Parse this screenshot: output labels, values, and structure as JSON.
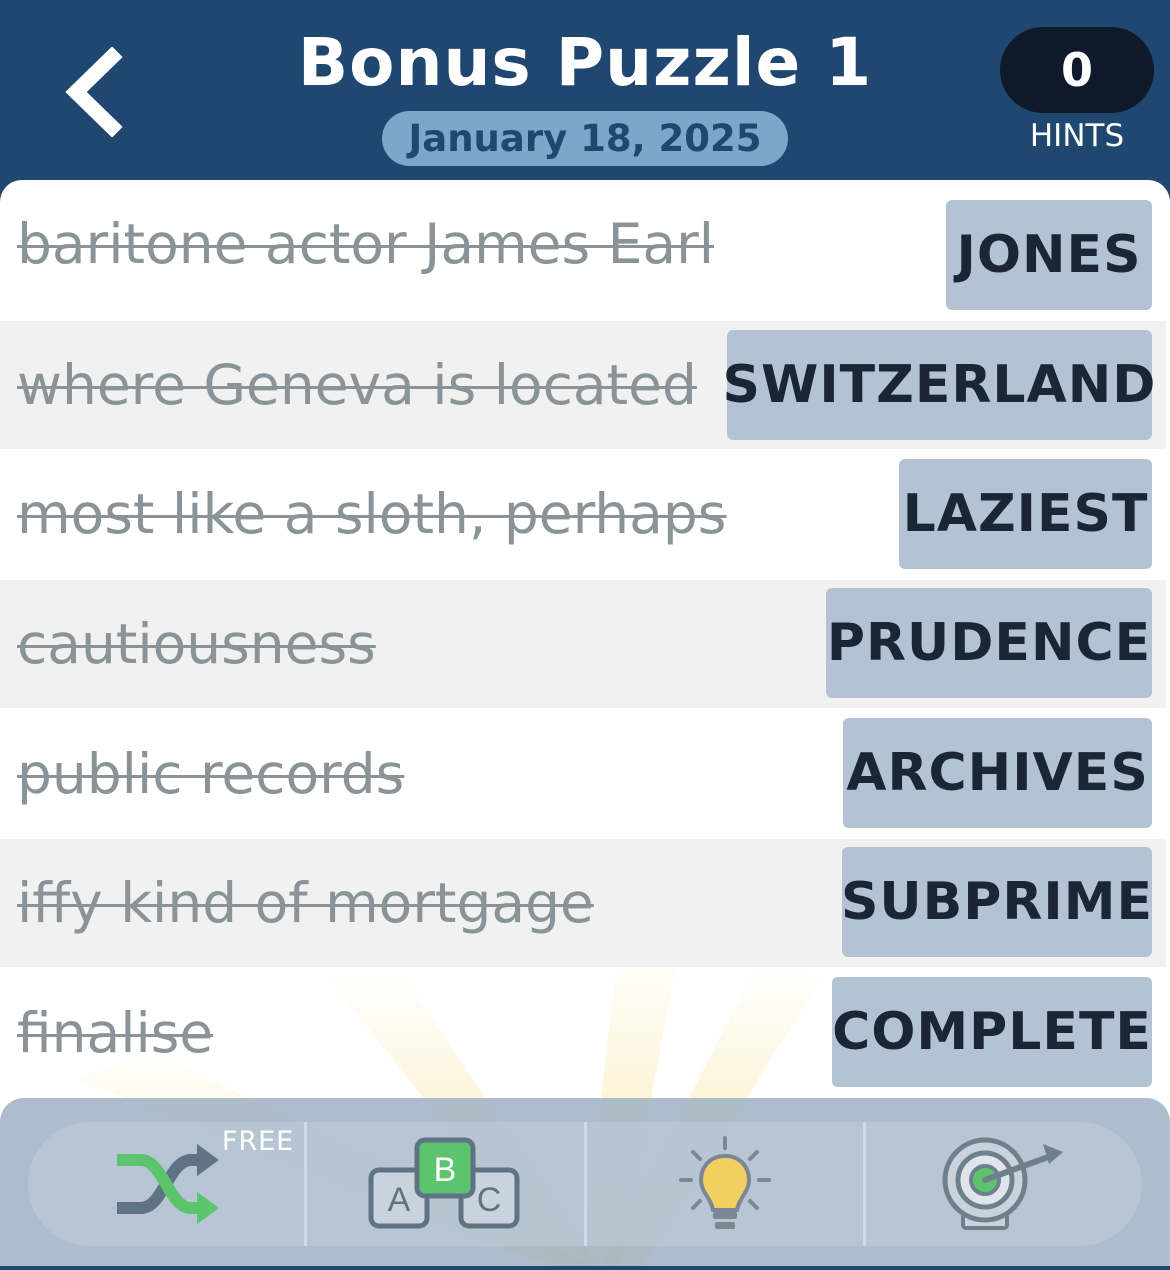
{
  "header": {
    "title": "Bonus Puzzle 1",
    "date": "January 18, 2025",
    "hints_count": "0",
    "hints_label": "HINTS"
  },
  "clues": [
    {
      "clue": "baritone actor James Earl",
      "answer": "JONES"
    },
    {
      "clue": "where Geneva is located",
      "answer": "SWITZERLAND"
    },
    {
      "clue": "most like a sloth, perhaps",
      "answer": "LAZIEST"
    },
    {
      "clue": "cautiousness",
      "answer": "PRUDENCE"
    },
    {
      "clue": "public records",
      "answer": "ARCHIVES"
    },
    {
      "clue": "iffy kind of mortgage",
      "answer": "SUBPRIME"
    },
    {
      "clue": "finalise",
      "answer": "COMPLETE"
    }
  ],
  "toolbar": {
    "shuffle_badge": "FREE",
    "blocks_letters": [
      "A",
      "B",
      "C"
    ],
    "icons": [
      "shuffle-icon",
      "abc-blocks-icon",
      "lightbulb-icon",
      "target-icon"
    ]
  },
  "colors": {
    "header_bg": "#1f4770",
    "date_pill": "#7ea6cb",
    "answer_tile": "#b3c3d3",
    "clue_text": "#8a9398",
    "alt_row": "#f1f1f1",
    "green": "#5cc46d"
  }
}
